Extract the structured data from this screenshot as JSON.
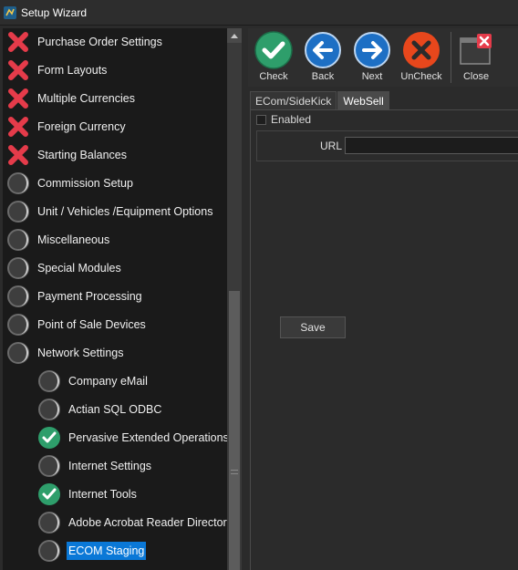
{
  "window": {
    "title": "Setup Wizard"
  },
  "tree": {
    "items": [
      {
        "label": "Purchase Order Settings",
        "status": "error"
      },
      {
        "label": "Form Layouts",
        "status": "error"
      },
      {
        "label": "Multiple Currencies",
        "status": "error"
      },
      {
        "label": "Foreign Currency",
        "status": "error"
      },
      {
        "label": "Starting Balances",
        "status": "error"
      },
      {
        "label": "Commission Setup",
        "status": "pending"
      },
      {
        "label": "Unit / Vehicles /Equipment Options",
        "status": "pending"
      },
      {
        "label": "Miscellaneous",
        "status": "pending"
      },
      {
        "label": "Special Modules",
        "status": "pending"
      },
      {
        "label": "Payment Processing",
        "status": "pending"
      },
      {
        "label": "Point of Sale Devices",
        "status": "pending"
      },
      {
        "label": "Network Settings",
        "status": "pending"
      },
      {
        "label": "Company eMail",
        "status": "pending"
      },
      {
        "label": "Actian SQL ODBC",
        "status": "pending"
      },
      {
        "label": "Pervasive Extended Operations",
        "status": "done"
      },
      {
        "label": "Internet Settings",
        "status": "pending"
      },
      {
        "label": "Internet Tools",
        "status": "done"
      },
      {
        "label": "Adobe Acrobat Reader Directory",
        "status": "pending"
      },
      {
        "label": "ECOM Staging",
        "status": "pending"
      }
    ]
  },
  "toolbar": {
    "check_label": "Check",
    "back_label": "Back",
    "next_label": "Next",
    "uncheck_label": "UnCheck",
    "close_label": "Close"
  },
  "tabs": [
    {
      "label": "ECom/SideKick"
    },
    {
      "label": "WebSell"
    }
  ],
  "form": {
    "enabled_label": "Enabled",
    "url_label": "URL",
    "url_value": "",
    "save_label": "Save"
  },
  "colors": {
    "check_green": "#2e9e6b",
    "nav_blue": "#1d6fc4",
    "uncheck_red": "#e8471c",
    "error_red": "#e53b4a",
    "selection": "#0a78d7"
  }
}
